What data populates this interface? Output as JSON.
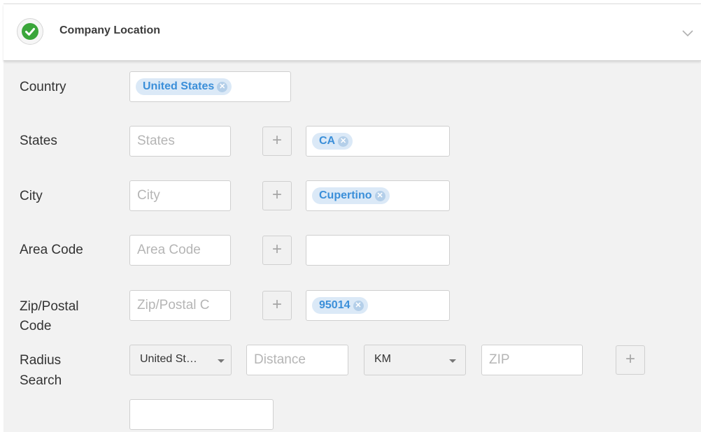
{
  "header": {
    "title": "Company Location"
  },
  "icons": {
    "status": "check-circle-icon",
    "toggle": "chevron-down-icon",
    "add": "plus-icon",
    "remove": "close-icon",
    "dropdown": "caret-down-icon"
  },
  "colors": {
    "success": "#3aa63a",
    "tag_bg": "#dbe9f7",
    "tag_text": "#3b8fd9"
  },
  "country": {
    "label": "Country",
    "tags": [
      "United States"
    ]
  },
  "states": {
    "label": "States",
    "placeholder": "States",
    "add": "+",
    "tags": [
      "CA"
    ]
  },
  "city": {
    "label": "City",
    "placeholder": "City",
    "add": "+",
    "tags": [
      "Cupertino"
    ]
  },
  "area_code": {
    "label": "Area Code",
    "placeholder": "Area Code",
    "add": "+",
    "tags": []
  },
  "zip": {
    "label_line1": "Zip/Postal",
    "label_line2": "Code",
    "placeholder": "Zip/Postal C",
    "add": "+",
    "tags": [
      "95014"
    ]
  },
  "radius": {
    "label_line1": "Radius",
    "label_line2": "Search",
    "country_select": "United St…",
    "distance_placeholder": "Distance",
    "unit_select": "KM",
    "zip_placeholder": "ZIP",
    "add": "+"
  }
}
